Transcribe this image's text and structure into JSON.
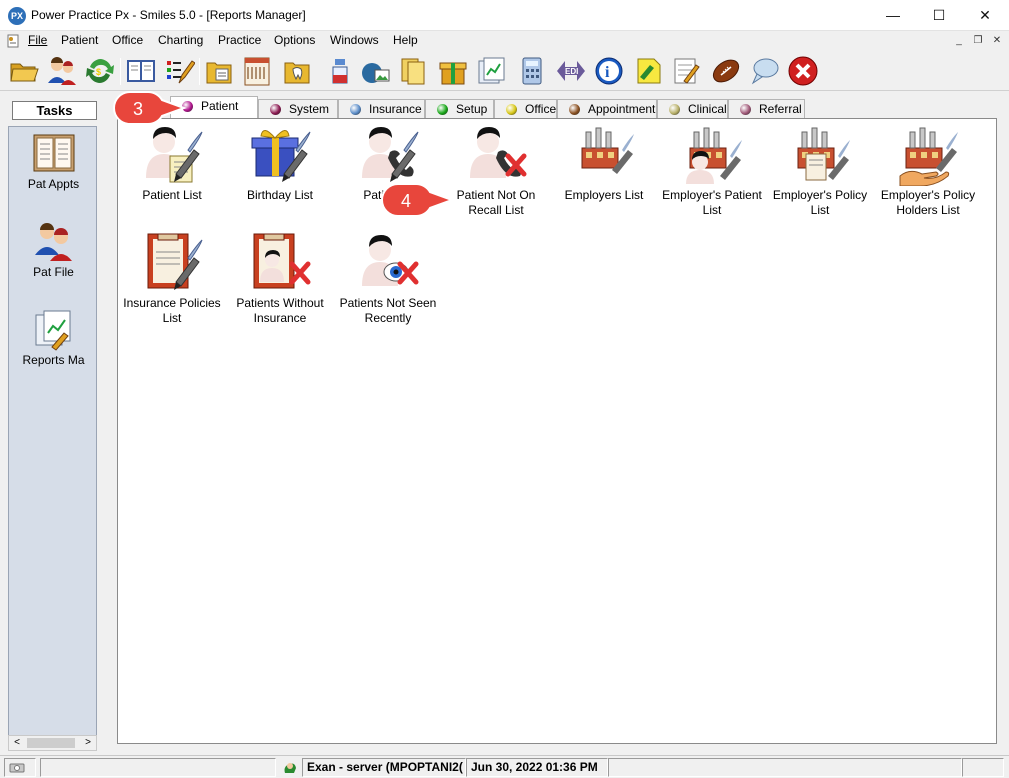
{
  "window": {
    "title": "Power Practice Px - Smiles 5.0 - [Reports Manager]",
    "logo_text": "PX",
    "min_glyph": "—",
    "max_glyph": "☐",
    "close_glyph": "✕"
  },
  "menu": {
    "items": [
      "File",
      "Patient",
      "Office",
      "Charting",
      "Practice",
      "Options",
      "Windows",
      "Help"
    ],
    "mdi_min": "_",
    "mdi_restore": "❐",
    "mdi_close": "✕"
  },
  "toolbar": {
    "buttons": [
      "open-folder-icon",
      "patients-icon",
      "refresh-icon",
      "appointment-book-icon",
      "edit-list-icon",
      "patient-file-icon",
      "chart-icon",
      "dental-icon",
      "lab-icon",
      "image-icon",
      "folders-icon",
      "gift-box-icon",
      "reports-icon",
      "calculator-icon",
      "edi-icon",
      "info-icon",
      "notes-icon",
      "checklist-icon",
      "football-icon",
      "chat-bubble-icon",
      "exit-icon"
    ]
  },
  "tasks": {
    "title": "Tasks",
    "items": [
      {
        "label": "Pat Appts",
        "icon": "pat-appts-icon"
      },
      {
        "label": "Pat File",
        "icon": "pat-file-icon"
      },
      {
        "label": "Reports Ma",
        "icon": "reports-manager-icon"
      }
    ],
    "scroll_left": "<",
    "scroll_right": ">"
  },
  "tabs": [
    {
      "label": "Patient",
      "color": "#b0148c",
      "active": true
    },
    {
      "label": "System",
      "color": "#8a1850"
    },
    {
      "label": "Insurance",
      "color": "#5a8cc8"
    },
    {
      "label": "Setup",
      "color": "#18a818"
    },
    {
      "label": "Office",
      "color": "#d8c818"
    },
    {
      "label": "Appointment",
      "color": "#8a5020"
    },
    {
      "label": "Clinical",
      "color": "#b8b068"
    },
    {
      "label": "Referral",
      "color": "#a05878"
    }
  ],
  "reports": [
    {
      "label_lines": [
        "Patient List"
      ],
      "icon": "patient-list-icon"
    },
    {
      "label_lines": [
        "Birthday List"
      ],
      "icon": "birthday-gift-icon"
    },
    {
      "label_lines": [
        "Patient R"
      ],
      "icon": "patient-recall-phone-icon"
    },
    {
      "label_lines": [
        "Patient Not On",
        "Recall List"
      ],
      "icon": "patient-not-on-recall-icon"
    },
    {
      "label_lines": [
        "Employers List"
      ],
      "icon": "employers-factory-icon"
    },
    {
      "label_lines": [
        "Employer's Patient",
        "List"
      ],
      "icon": "employer-patient-icon"
    },
    {
      "label_lines": [
        "Employer's Policy",
        "List"
      ],
      "icon": "employer-policy-icon"
    },
    {
      "label_lines": [
        "Employer's Policy",
        "Holders List"
      ],
      "icon": "employer-policy-holders-icon"
    },
    {
      "label_lines": [
        "Insurance Policies",
        "List"
      ],
      "icon": "insurance-policies-icon"
    },
    {
      "label_lines": [
        "Patients Without",
        "Insurance"
      ],
      "icon": "patients-without-insurance-icon"
    },
    {
      "label_lines": [
        "Patients Not Seen",
        "Recently"
      ],
      "icon": "patients-not-seen-icon"
    }
  ],
  "callouts": [
    {
      "number": "3",
      "color": "#e8463c"
    },
    {
      "number": "4",
      "color": "#e8463c"
    }
  ],
  "status": {
    "user": "Exan - server (MPOPTANI2(",
    "datetime": "Jun 30, 2022 01:36 PM"
  }
}
